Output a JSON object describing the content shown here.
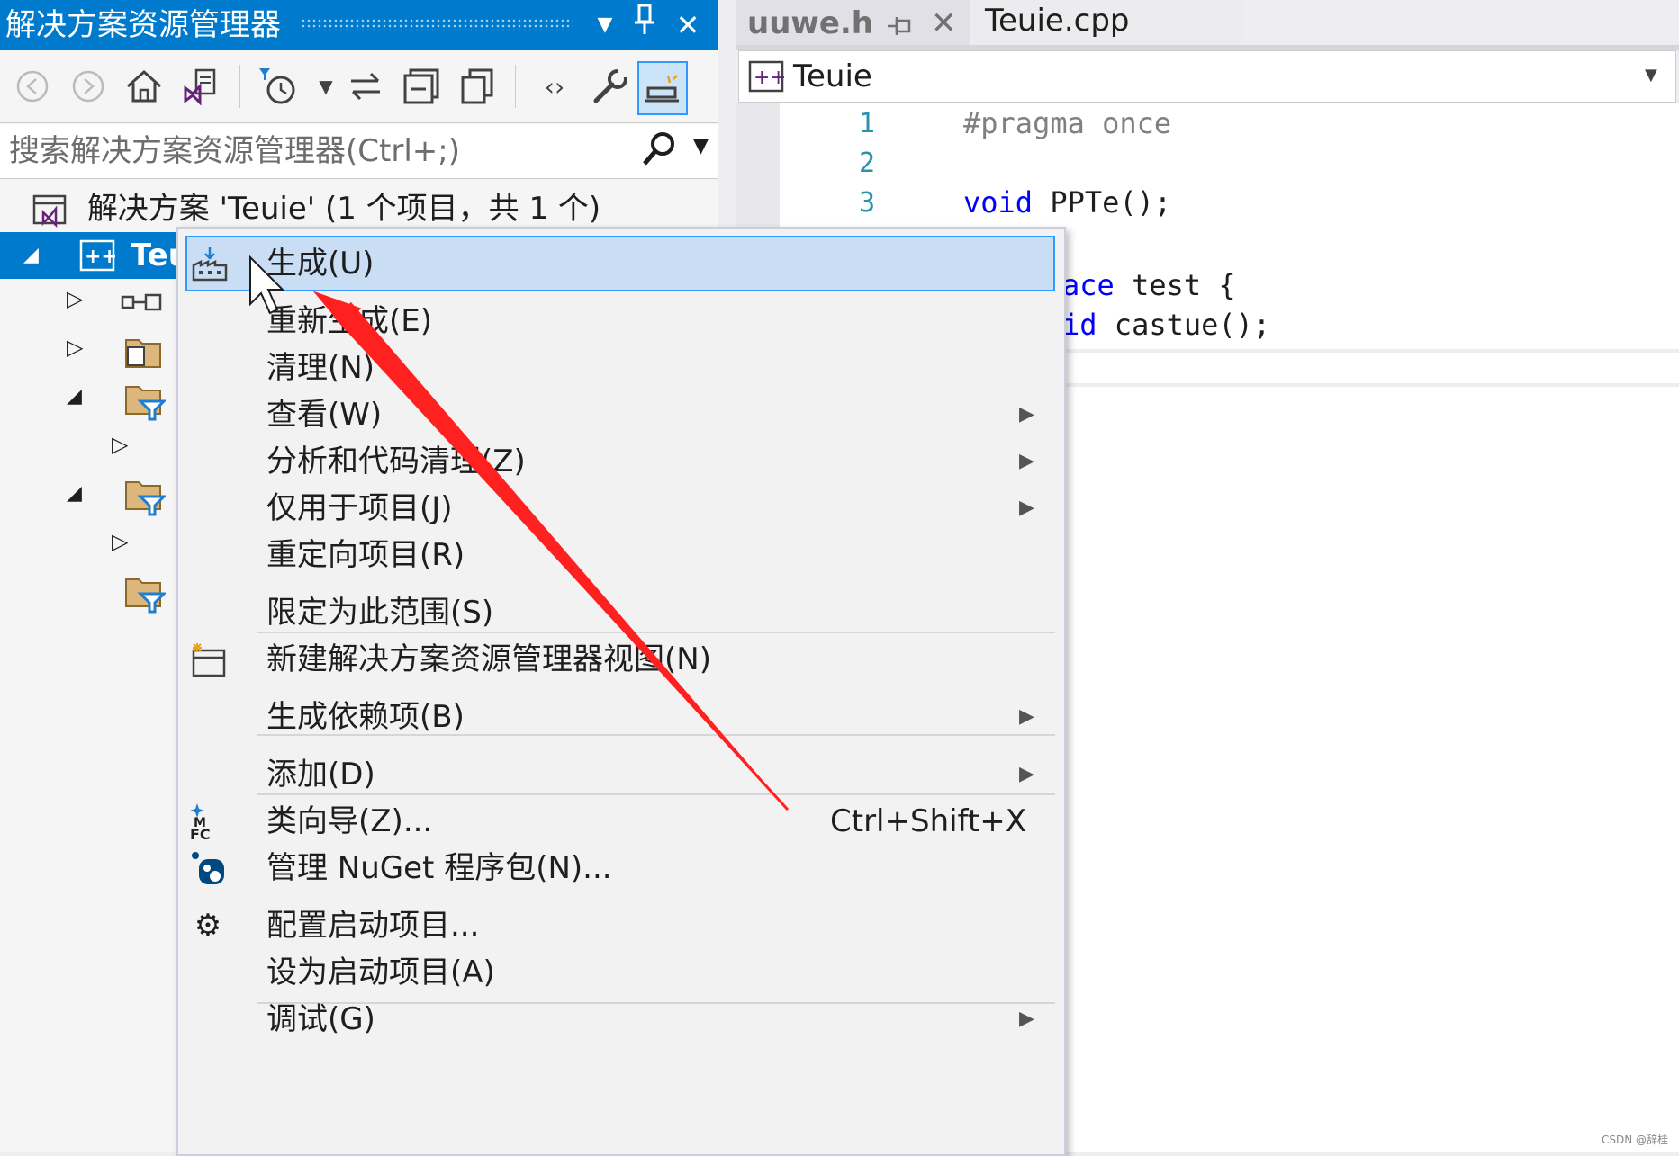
{
  "solution_explorer": {
    "title": "解决方案资源管理器",
    "pin_icon": "pin-icon",
    "close_icon": "close-icon",
    "search_placeholder": "搜索解决方案资源管理器(Ctrl+;)",
    "solution_label": "解决方案 'Teuie' (1 个项目，共 1 个)",
    "project_label": "Teu",
    "toolbar_icons": [
      "back-icon",
      "forward-icon",
      "home-icon",
      "switch-views-icon",
      "pending-changes-filter-icon",
      "sync-icon",
      "collapse-all-icon",
      "show-all-files-icon",
      "view-code-icon",
      "properties-icon",
      "preview-selected-icon"
    ]
  },
  "editor": {
    "tabs": [
      {
        "label": "uuwe.h"
      },
      {
        "label": "Teuie.cpp"
      }
    ],
    "nav_project": "Teuie",
    "lines": [
      {
        "num": "1",
        "text": "#pragma once"
      },
      {
        "num": "2",
        "text": ""
      },
      {
        "num": "3",
        "text": "void PPTe();"
      },
      {
        "num": "",
        "text": "ace test {"
      },
      {
        "num": "",
        "text": "id castue();"
      }
    ]
  },
  "context_menu": {
    "items": [
      {
        "label": "生成(U)",
        "icon": "build-icon"
      },
      {
        "label": "重新生成(E)"
      },
      {
        "label": "清理(N)"
      },
      {
        "label": "查看(W)",
        "submenu": true
      },
      {
        "label": "分析和代码清理(Z)",
        "submenu": true
      },
      {
        "label": "仅用于项目(J)",
        "submenu": true
      },
      {
        "label": "重定向项目(R)"
      },
      {
        "label": "限定为此范围(S)"
      },
      {
        "label": "新建解决方案资源管理器视图(N)",
        "icon": "new-view-icon"
      },
      {
        "label": "生成依赖项(B)",
        "submenu": true
      },
      {
        "label": "添加(D)",
        "submenu": true
      },
      {
        "label": "类向导(Z)...",
        "icon": "class-wizard-icon",
        "shortcut": "Ctrl+Shift+X"
      },
      {
        "label": "管理 NuGet 程序包(N)...",
        "icon": "nuget-icon"
      },
      {
        "label": "配置启动项目...",
        "icon": "gear-icon"
      },
      {
        "label": "设为启动项目(A)"
      },
      {
        "label": "调试(G)",
        "submenu": true
      }
    ]
  },
  "watermark": "CSDN @辞桂",
  "colors": {
    "accent": "#007acc",
    "highlight": "#c9def5",
    "arrow": "#ff2020"
  }
}
